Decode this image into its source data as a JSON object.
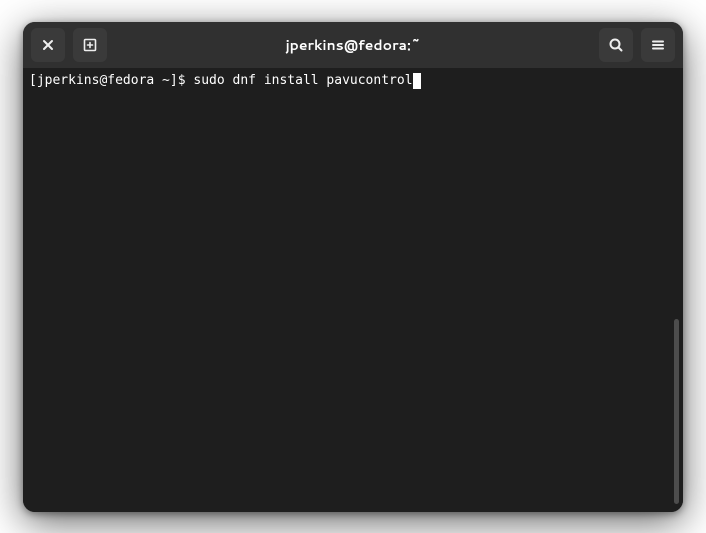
{
  "window": {
    "title": "jperkins@fedora:~"
  },
  "titlebar": {
    "close_label": "Close",
    "newtab_label": "New Tab",
    "search_label": "Search",
    "menu_label": "Menu"
  },
  "terminal": {
    "prompt": "[jperkins@fedora ~]$ ",
    "command": "sudo dnf install pavucontrol"
  }
}
